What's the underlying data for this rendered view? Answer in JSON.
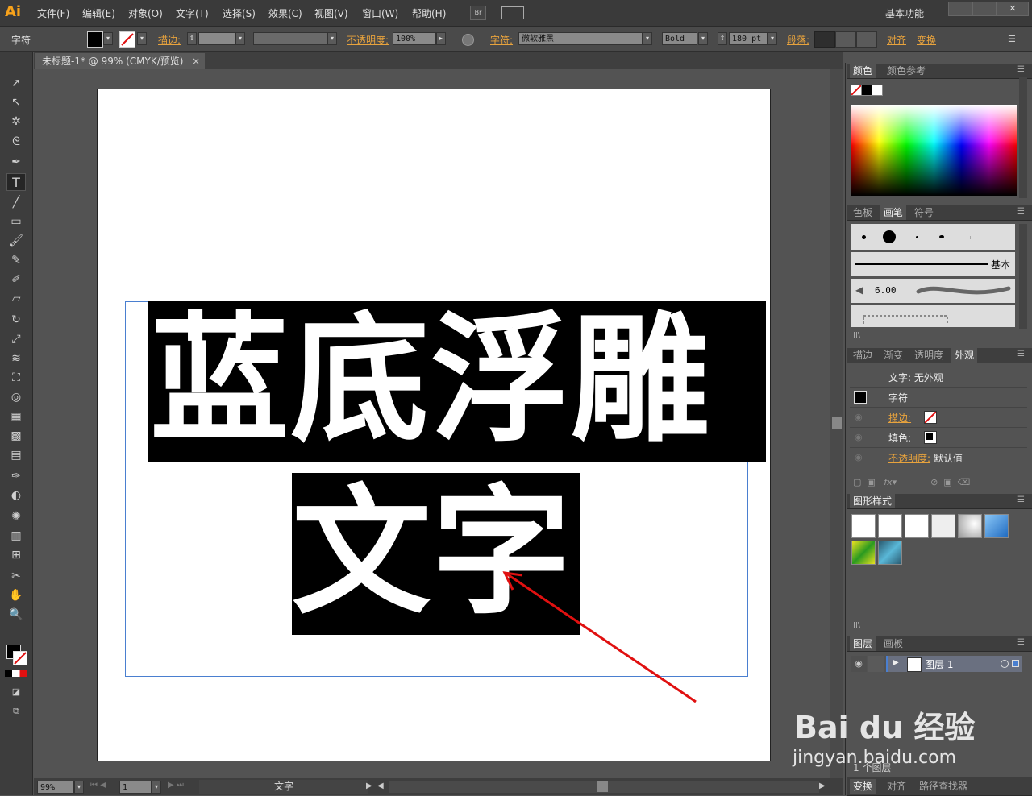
{
  "app": {
    "logo": "Ai",
    "workspace": "基本功能"
  },
  "menu": [
    "文件(F)",
    "编辑(E)",
    "对象(O)",
    "文字(T)",
    "选择(S)",
    "效果(C)",
    "视图(V)",
    "窗口(W)",
    "帮助(H)"
  ],
  "menu_extra": {
    "br": "Br"
  },
  "control": {
    "tool_label": "字符",
    "stroke_label": "描边:",
    "opacity_label": "不透明度:",
    "opacity_value": "100%",
    "char_label": "字符:",
    "font_family": "微软雅黑",
    "font_style": "Bold",
    "font_size": "180 pt",
    "para_label": "段落:",
    "align_label": "对齐",
    "transform_label": "变换"
  },
  "document": {
    "tab_title": "未标题-1* @ 99% (CMYK/预览)",
    "text_line1": "蓝底浮雕",
    "text_line2": "文字"
  },
  "statusbar": {
    "zoom": "99%",
    "page": "1",
    "status_text": "文字"
  },
  "panels": {
    "color": {
      "tabs": [
        "颜色",
        "颜色参考"
      ]
    },
    "brushes": {
      "tabs": [
        "色板",
        "画笔",
        "符号"
      ],
      "basic_label": "基本",
      "size_value": "6.00"
    },
    "appearance": {
      "tabs": [
        "描边",
        "渐变",
        "透明度",
        "外观"
      ],
      "header": "文字: 无外观",
      "type_row": "字符",
      "stroke_label": "描边:",
      "fill_label": "填色:",
      "opacity_label": "不透明度:",
      "opacity_value": "默认值"
    },
    "graphic_styles": {
      "title": "图形样式"
    },
    "layers": {
      "tabs": [
        "图层",
        "画板"
      ],
      "layer_name": "图层 1",
      "footer": "1 个图层"
    },
    "bottom_tabs": [
      "变换",
      "对齐",
      "路径查找器"
    ]
  },
  "watermark": {
    "brand": "Bai du 经验",
    "url": "jingyan.baidu.com"
  },
  "colors": {
    "accent_orange": "#e8a33d",
    "arrow_red": "#e01010",
    "selection_blue": "#4a7fd0"
  }
}
